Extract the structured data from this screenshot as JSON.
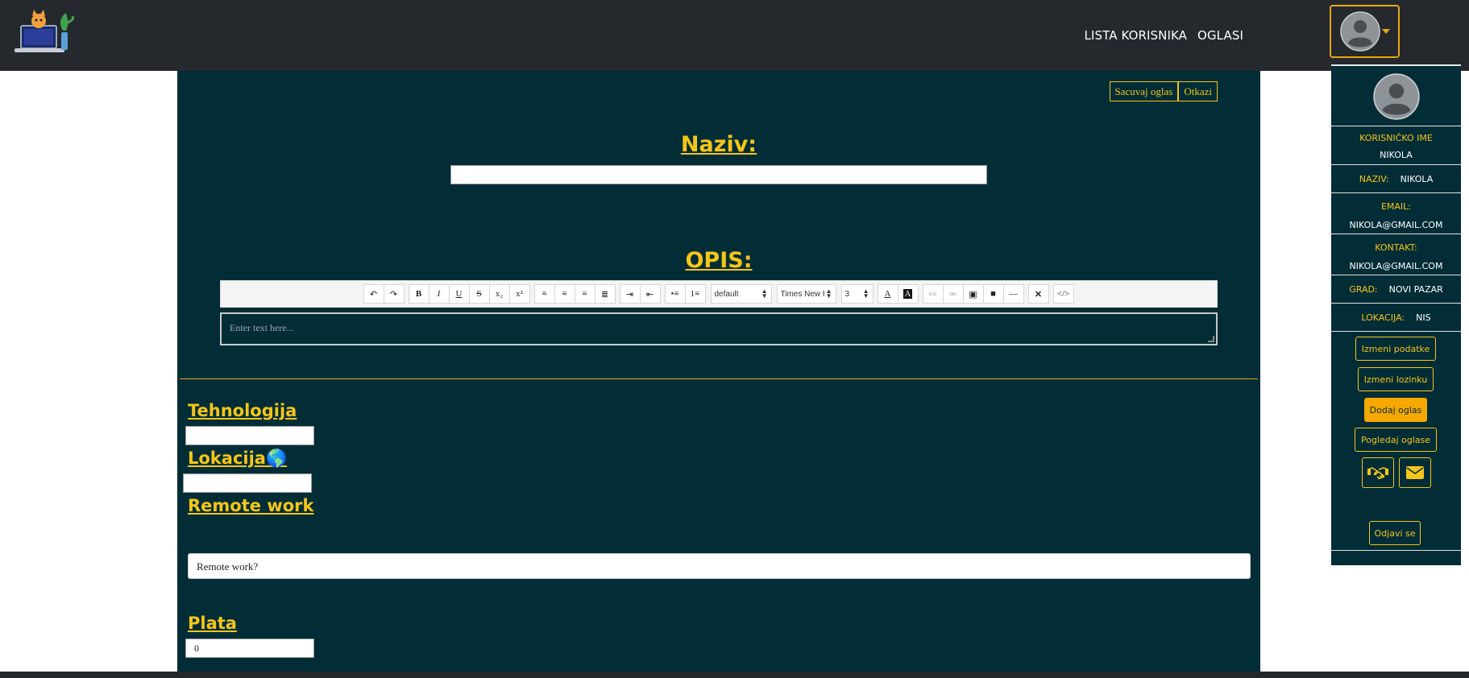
{
  "navbar": {
    "links": [
      "LISTA KORISNIKA",
      "OGLASI"
    ]
  },
  "form": {
    "actions": {
      "save": "Sacuvaj oglas",
      "cancel": "Otkazi"
    },
    "naziv_heading": "Naziv:",
    "naziv_value": "",
    "opis_heading": "OPIS:",
    "editor": {
      "format_select": "default",
      "font_select": "Times New R",
      "size_select": "3",
      "placeholder": "Enter text here..."
    },
    "tehnologija_heading": "Tehnologija",
    "tehnologija_value": "",
    "lokacija_heading": "Lokacija🌎",
    "lokacija_value": "",
    "remote_heading": "Remote work",
    "remote_value": "Remote work?",
    "plata_heading": "Plata",
    "plata_value": "0"
  },
  "profile": {
    "korisnicko_ime_label": "KORISNIČKO IME",
    "korisnicko_ime": "NIKOLA",
    "naziv_label": "NAZIV:",
    "naziv": "NIKOLA",
    "email_label": "EMAIL:",
    "email": "NIKOLA@GMAIL.COM",
    "kontakt_label": "KONTAKT:",
    "kontakt": "NIKOLA@GMAIL.COM",
    "grad_label": "GRAD:",
    "grad": "NOVI PAZAR",
    "lokacija_label": "LOKACIJA:",
    "lokacija": "NIS",
    "buttons": {
      "izmeni_podatke": "Izmeni podatke",
      "izmeni_lozinku": "Izmeni lozinku",
      "dodaj_oglas": "Dodaj oglas",
      "pogledaj_oglase": "Pogledaj oglase",
      "odjavi_se": "Odjavi se"
    },
    "icons": [
      "handshake-icon",
      "envelope-icon"
    ]
  },
  "colors": {
    "navbar": "#25282c",
    "panel": "#022d37",
    "accent": "#f5c518",
    "button_filled": "#f5a800"
  }
}
